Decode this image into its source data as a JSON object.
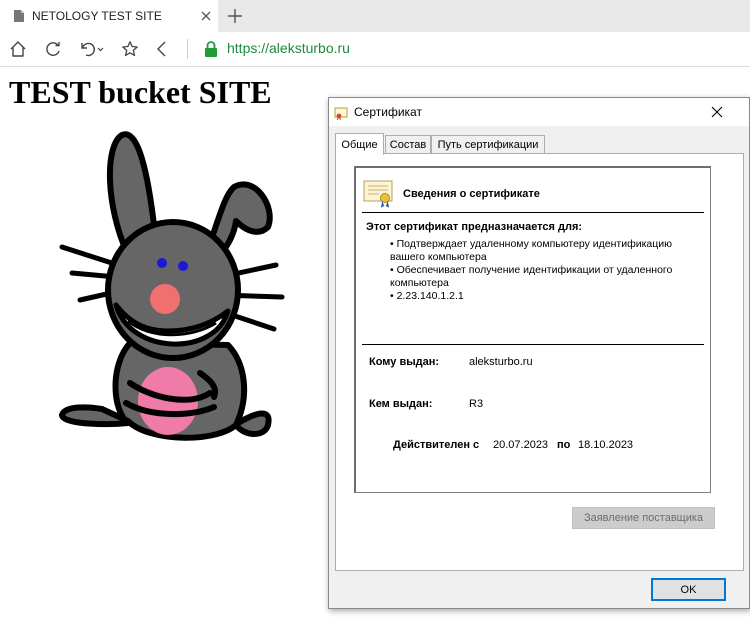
{
  "browser": {
    "tab_title": "NETOLOGY TEST SITE",
    "url": "https://aleksturbo.ru"
  },
  "page": {
    "title": "TEST bucket SITE"
  },
  "dialog": {
    "title": "Сертификат",
    "tabs": [
      "Общие",
      "Состав",
      "Путь сертификации"
    ],
    "heading": "Сведения о сертификате",
    "purpose_heading": "Этот сертификат предназначается для:",
    "purposes": [
      "Подтверждает удаленному компьютеру идентификацию вашего компьютера",
      "Обеспечивает получение идентификации от удаленного компьютера",
      "2.23.140.1.2.1"
    ],
    "issued_to_label": "Кому выдан:",
    "issued_to_value": "aleksturbo.ru",
    "issued_by_label": "Кем выдан:",
    "issued_by_value": "R3",
    "valid_from_label": "Действителен с",
    "valid_from_value": "20.07.2023",
    "valid_to_label": "по",
    "valid_to_value": "18.10.2023",
    "issuer_statement_button": "Заявление поставщика",
    "ok_button": "OK"
  }
}
